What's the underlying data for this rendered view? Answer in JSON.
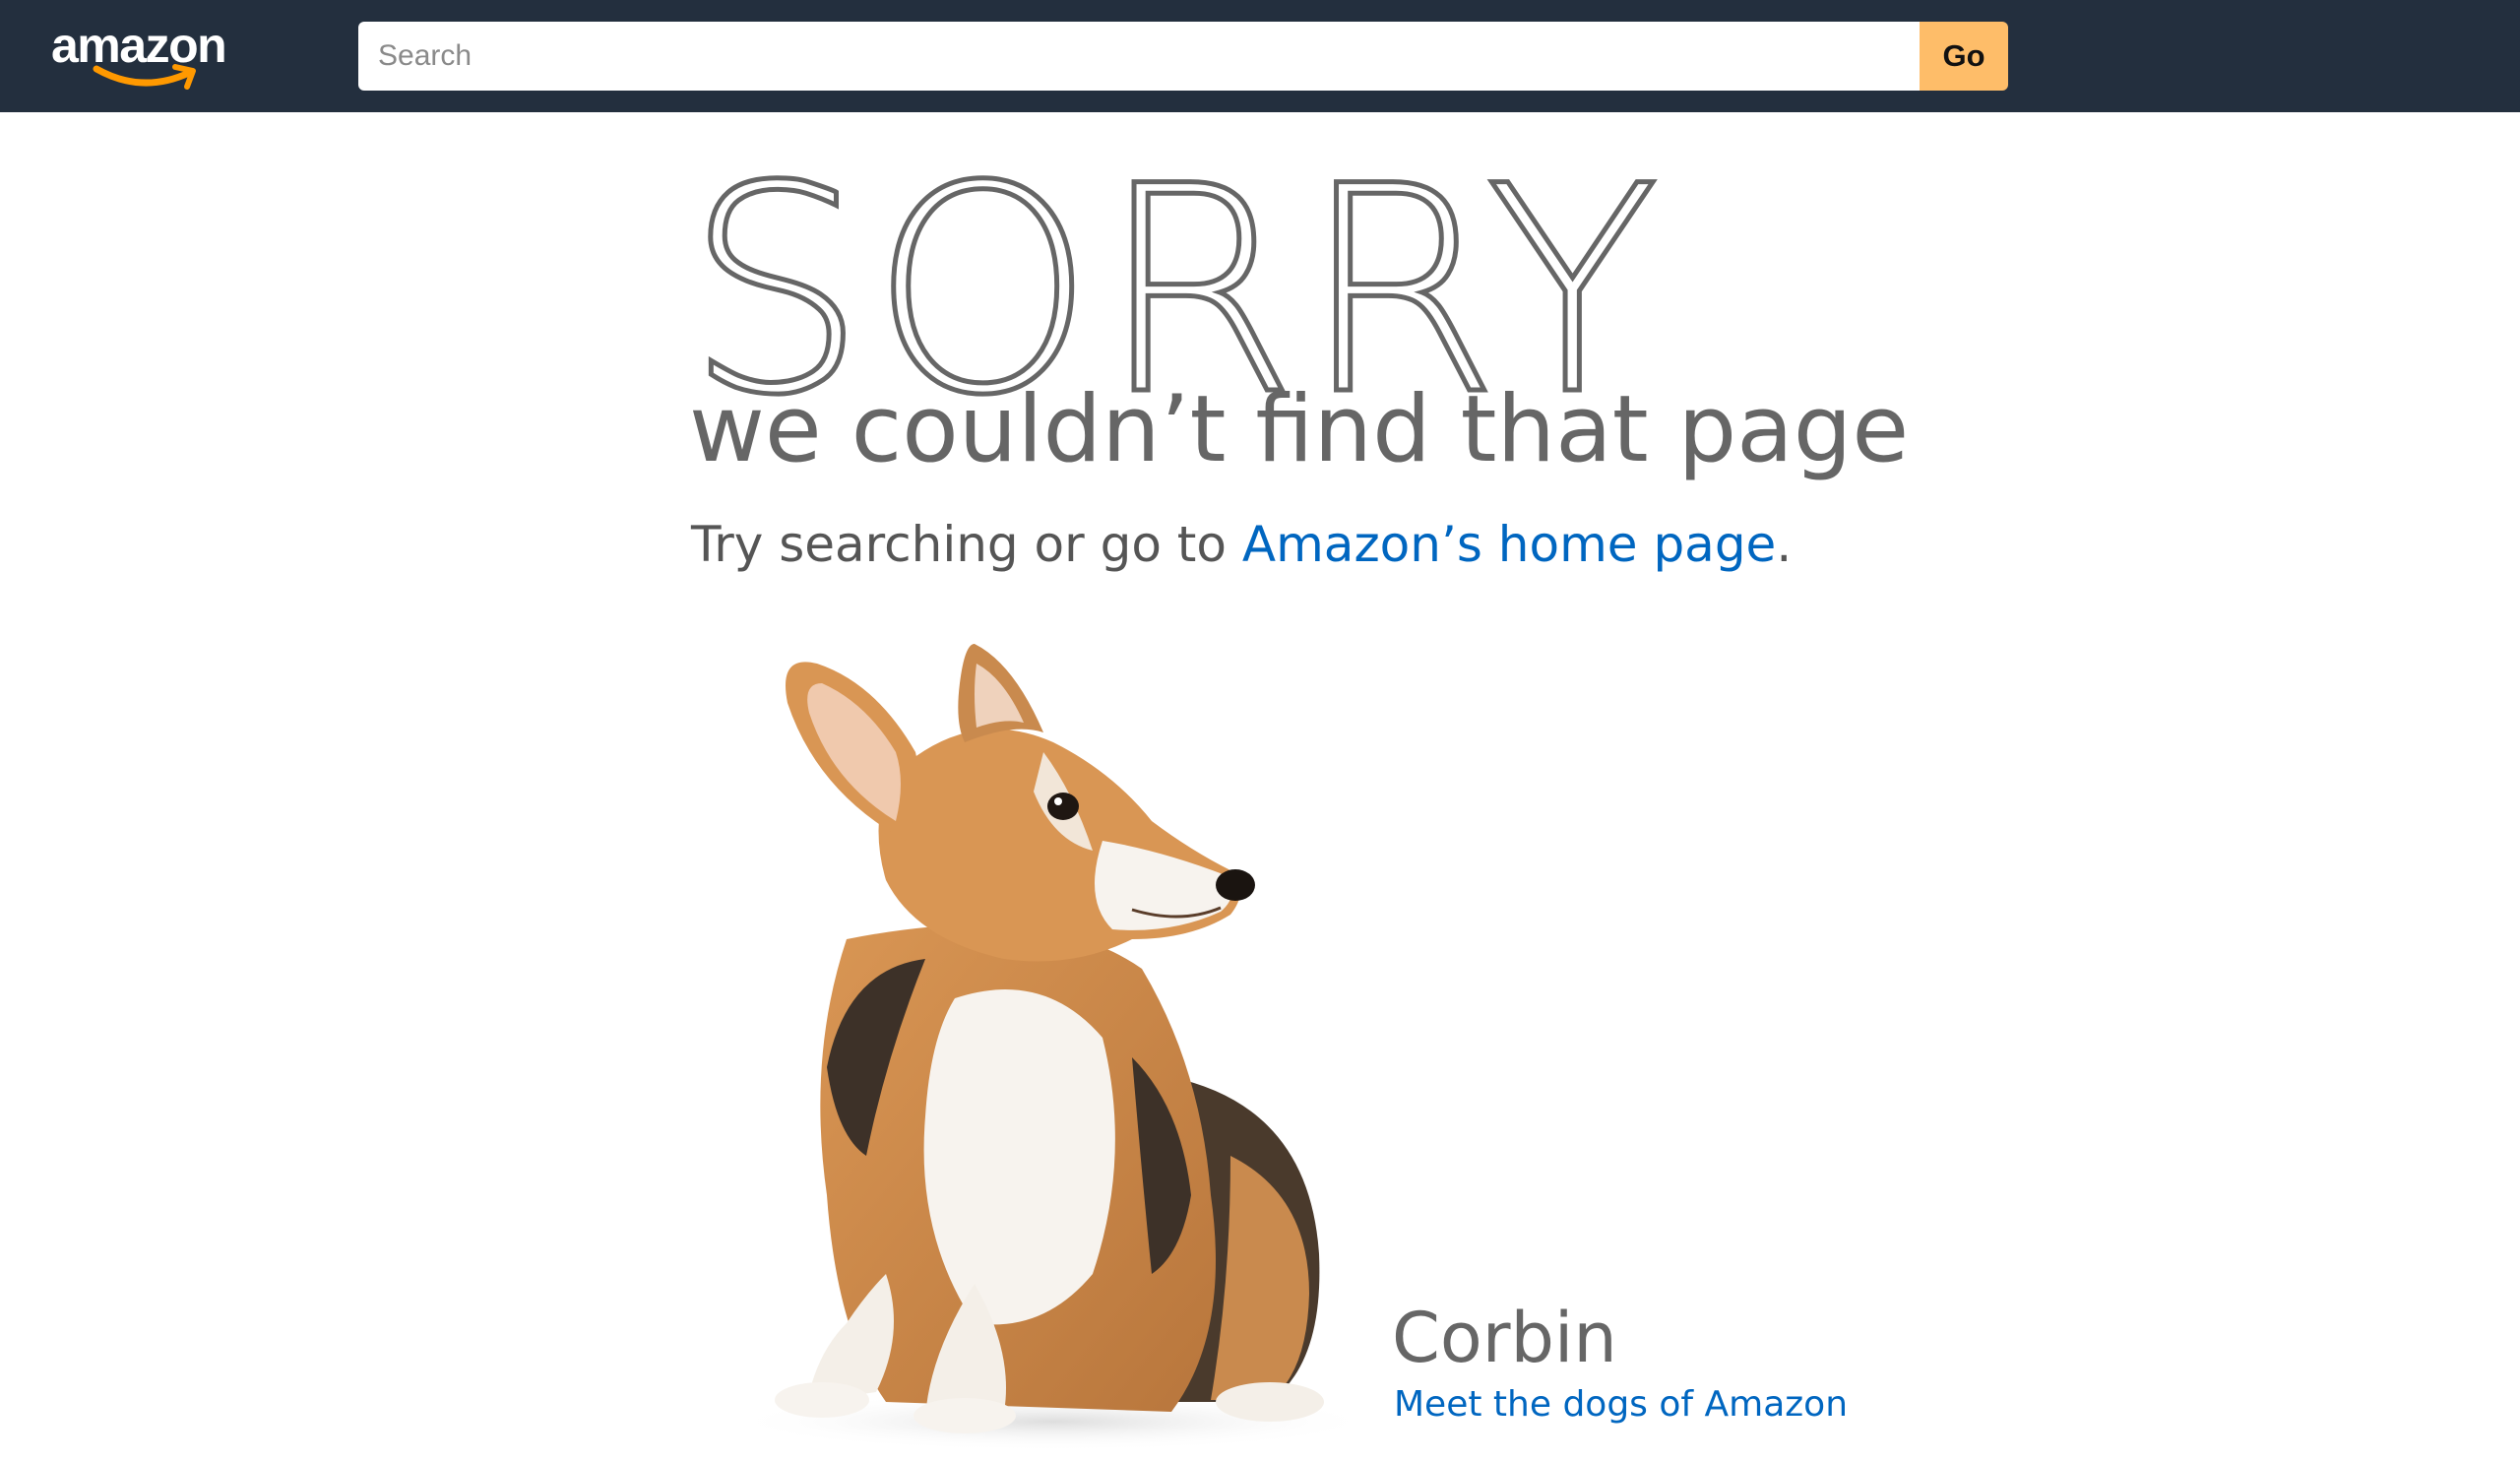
{
  "header": {
    "logo_text": "amazon",
    "search": {
      "placeholder": "Search",
      "value": ""
    },
    "go_label": "Go"
  },
  "error": {
    "heading": "SORRY",
    "subtitle": "we couldn’t find that page",
    "message_prefix": "Try searching or go to ",
    "home_link_label": "Amazon’s home page",
    "message_suffix": "."
  },
  "dog": {
    "name": "Corbin",
    "link_label": "Meet the dogs of Amazon"
  },
  "colors": {
    "header_bg": "#232f3e",
    "go_button": "#febd69",
    "link": "#0066c0",
    "text_gray": "#666666",
    "logo_smile": "#ff9900"
  }
}
